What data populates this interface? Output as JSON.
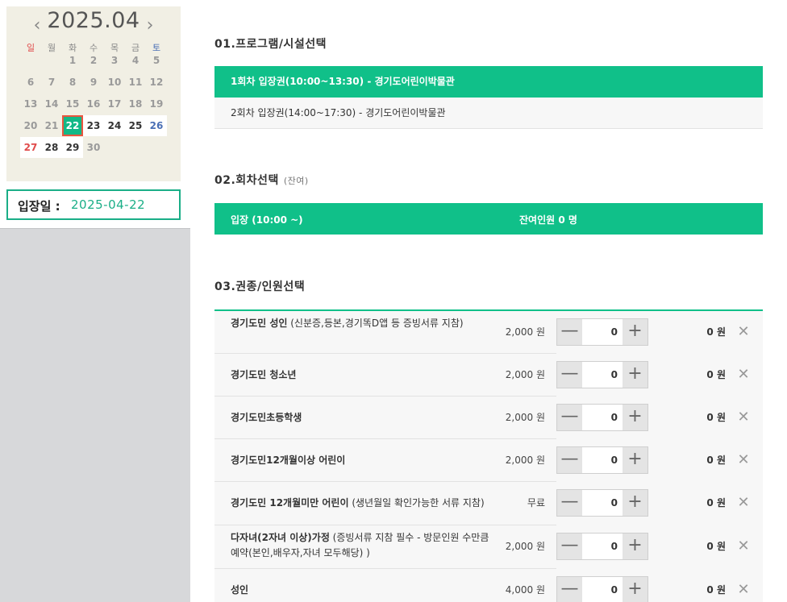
{
  "calendar": {
    "title": "2025.04",
    "prev_label": "‹",
    "next_label": "›",
    "weekdays": [
      "일",
      "월",
      "화",
      "수",
      "목",
      "금",
      "토"
    ],
    "weeks": [
      [
        "",
        "",
        "1",
        "2",
        "3",
        "4",
        "5"
      ],
      [
        "6",
        "7",
        "8",
        "9",
        "10",
        "11",
        "12"
      ],
      [
        "13",
        "14",
        "15",
        "16",
        "17",
        "18",
        "19"
      ],
      [
        "20",
        "21",
        "22",
        "23",
        "24",
        "25",
        "26"
      ],
      [
        "27",
        "28",
        "29",
        "30",
        "",
        "",
        ""
      ]
    ],
    "available_days": [
      "22",
      "23",
      "24",
      "25",
      "26",
      "27",
      "28",
      "29"
    ],
    "selected_day": "22"
  },
  "entry": {
    "label": "입장일 :",
    "date": "2025-04-22"
  },
  "sections": {
    "program": "01.프로그램/시설선택",
    "round": "02.회차선택",
    "round_sub": "(잔여)",
    "ticket": "03.권종/인원선택"
  },
  "programs": [
    {
      "label": "1회차 입장권(10:00~13:30) - 경기도어린이박물관",
      "active": true
    },
    {
      "label": "2회차 입장권(14:00~17:30) - 경기도어린이박물관",
      "active": false
    }
  ],
  "round": {
    "label": "입장 (10:00 ~)",
    "remaining": "잔여인원 0 명"
  },
  "tickets": [
    {
      "name": "경기도민 성인",
      "note": " (신분증,등본,경기똑D앱 등 증빙서류 지참)",
      "price": "2,000 원",
      "qty": "0",
      "total": "0 원"
    },
    {
      "name": "경기도민 청소년",
      "note": "",
      "price": "2,000 원",
      "qty": "0",
      "total": "0 원"
    },
    {
      "name": "경기도민초등학생",
      "note": "",
      "price": "2,000 원",
      "qty": "0",
      "total": "0 원"
    },
    {
      "name": "경기도민12개월이상 어린이",
      "note": "",
      "price": "2,000 원",
      "qty": "0",
      "total": "0 원"
    },
    {
      "name": "경기도민 12개월미만 어린이",
      "note": " (생년월일 확인가능한 서류 지참)",
      "price": "무료",
      "qty": "0",
      "total": "0 원"
    },
    {
      "name": "다자녀(2자녀 이상)가정",
      "note": " (증빙서류 지참 필수 - 방문인원 수만큼 예약(본인,배우자,자녀 모두해당) )",
      "price": "2,000 원",
      "qty": "0",
      "total": "0 원"
    },
    {
      "name": "성인",
      "note": "",
      "price": "4,000 원",
      "qty": "0",
      "total": "0 원"
    }
  ],
  "stepper_icons": {
    "minus": "—",
    "plus": "+",
    "remove": "✕"
  },
  "colors": {
    "accent": "#10c089",
    "selected_border": "#e8553f",
    "sunday": "#e04b4b",
    "saturday": "#4a6fb5"
  }
}
